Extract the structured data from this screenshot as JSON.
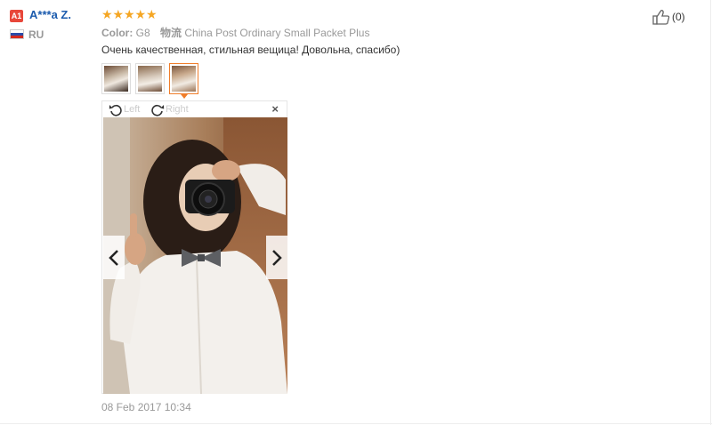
{
  "reviewer": {
    "badge": "A1",
    "name": "A***a Z.",
    "country": "RU",
    "flag_colors": [
      "#ffffff",
      "#2b4ca8",
      "#d52b1e"
    ]
  },
  "rating": {
    "stars": 5,
    "max": 5,
    "color": "#f5a623"
  },
  "order": {
    "color_label": "Color:",
    "color_value": "G8",
    "shipping_label": "物流",
    "shipping_value": "China Post Ordinary Small Packet Plus"
  },
  "review": {
    "text": "Очень качественная, стильная вещица! Довольна, спасибо)",
    "date": "08 Feb 2017 10:34"
  },
  "thumbnails": [
    {
      "name": "photo-thumb-1",
      "active": false
    },
    {
      "name": "photo-thumb-2",
      "active": false
    },
    {
      "name": "photo-thumb-3",
      "active": true
    }
  ],
  "viewer": {
    "rotate_left": "Left",
    "rotate_right": "Right",
    "close": "×",
    "prev_icon": "chevron-left-icon",
    "next_icon": "chevron-right-icon"
  },
  "helpful": {
    "count_text": "(0)"
  },
  "colors": {
    "accent": "#f07d2a",
    "link": "#1a5aad",
    "muted": "#999999"
  }
}
